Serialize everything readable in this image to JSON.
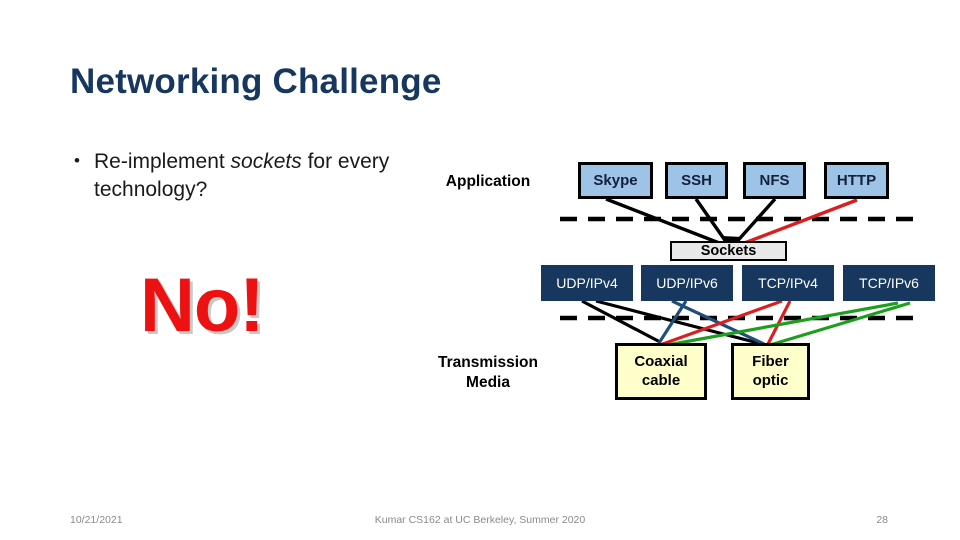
{
  "slide": {
    "title": "Networking Challenge",
    "bullet": {
      "marker": "•",
      "text_before": "Re-implement ",
      "text_italic": "sockets",
      "text_after": " for every technology?"
    },
    "emphasis": "No!"
  },
  "diagram": {
    "layer_labels": {
      "application": "Application",
      "transmission_line1": "Transmission",
      "transmission_line2": "Media"
    },
    "application_nodes": [
      {
        "label": "Skype"
      },
      {
        "label": "SSH"
      },
      {
        "label": "NFS"
      },
      {
        "label": "HTTP"
      }
    ],
    "sockets_node": {
      "label": "Sockets"
    },
    "protocol_nodes": [
      {
        "label": "UDP/IPv4",
        "line_color": "#000000"
      },
      {
        "label": "UDP/IPv6",
        "line_color": "#1F4E79"
      },
      {
        "label": "TCP/IPv4",
        "line_color": "#D91F1F"
      },
      {
        "label": "TCP/IPv6",
        "line_color": "#1E9E1E"
      }
    ],
    "media_nodes": [
      {
        "line1": "Coaxial",
        "line2": "cable"
      },
      {
        "line1": "Fiber",
        "line2": "optic"
      }
    ],
    "colors": {
      "app_box_fill": "#9DC3E6",
      "proto_box_fill": "#17375E",
      "media_box_fill": "#FFFFCC",
      "sockets_box_fill": "#E8E8E8",
      "title": "#17375E",
      "emphasis": "#EE1111",
      "http_link": "#D91F1F"
    }
  },
  "footer": {
    "date": "10/21/2021",
    "center": "Kumar CS162 at UC Berkeley, Summer 2020",
    "page": "28"
  }
}
